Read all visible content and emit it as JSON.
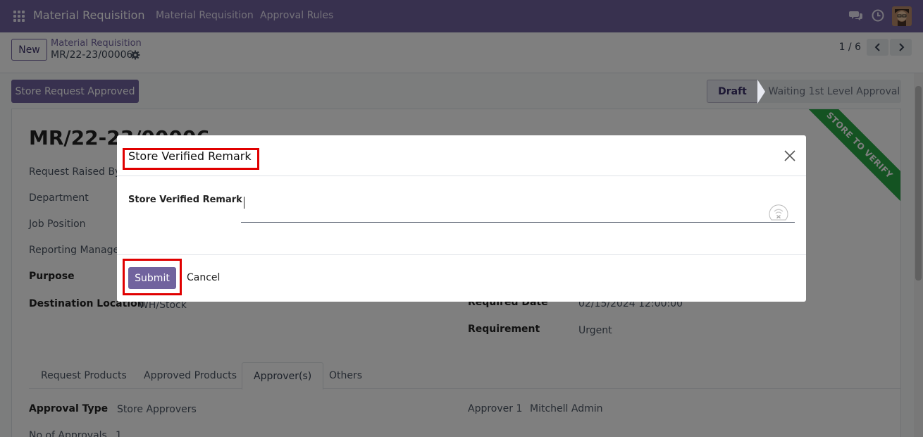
{
  "navbar": {
    "brand": "Material Requisition",
    "menu": [
      "Material Requisition",
      "Approval Rules"
    ],
    "icons": [
      "apps-grid-icon",
      "chat-icon",
      "clock-icon",
      "avatar"
    ],
    "color": "#71639e"
  },
  "control": {
    "new_label": "New",
    "breadcrumb_parent": "Material Requisition",
    "breadcrumb_current": "MR/22-23/00006",
    "pager": "1 / 6"
  },
  "status": {
    "action_button": "Store Request Approved",
    "stages": [
      "Draft",
      "Waiting 1st Level Approval"
    ],
    "ribbon": "STORE TO VERIFY",
    "ribbon_color": "#28a745"
  },
  "form": {
    "title": "MR/22-23/00006",
    "labels": {
      "request_raised_by": "Request Raised By",
      "department": "Department",
      "job_position": "Job Position",
      "reporting_manager": "Reporting Manager",
      "purpose": "Purpose",
      "destination_location": "Destination Location",
      "required_date": "Required Date",
      "requirement": "Requirement"
    },
    "values": {
      "destination_location": "WH/Stock",
      "required_date": "02/15/2024 12:00:00",
      "requirement": "Urgent"
    },
    "tabs": [
      "Request Products",
      "Approved Products",
      "Approver(s)",
      "Others"
    ],
    "active_tab": "Approver(s)",
    "approvers": {
      "approval_type_label": "Approval Type",
      "approval_type_value": "Store Approvers",
      "no_of_approvals_label": "No of Approvals",
      "no_of_approvals_value": "1",
      "approver1_label": "Approver 1",
      "approver1_value": "Mitchell Admin"
    }
  },
  "modal": {
    "title": "Store Verified Remark",
    "field_label": "Store Verified Remark",
    "field_value": "",
    "submit_label": "Submit",
    "cancel_label": "Cancel",
    "highlight_color": "#e00000"
  }
}
